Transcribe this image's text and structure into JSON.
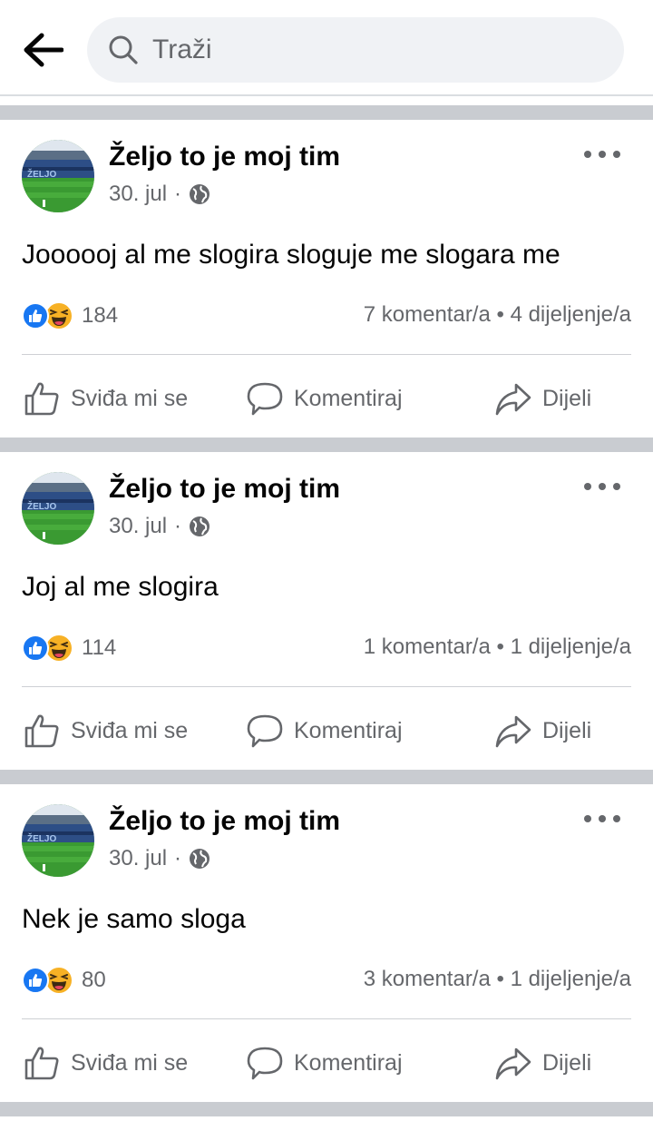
{
  "search": {
    "placeholder": "Traži"
  },
  "actions": {
    "like": "Sviđa mi se",
    "comment": "Komentiraj",
    "share": "Dijeli"
  },
  "posts": [
    {
      "author": "Željo to je moj tim",
      "date": "30. jul",
      "separator": "·",
      "text": "Joooooj al me slogira sloguje me slogara me",
      "reactions_count": "184",
      "stats": "7 komentar/a • 4 dijeljenje/a"
    },
    {
      "author": "Željo to je moj tim",
      "date": "30. jul",
      "separator": "·",
      "text": "Joj al me slogira",
      "reactions_count": "114",
      "stats": "1 komentar/a • 1 dijeljenje/a"
    },
    {
      "author": "Željo to je moj tim",
      "date": "30. jul",
      "separator": "·",
      "text": "Nek je samo sloga",
      "reactions_count": "80",
      "stats": "3 komentar/a • 1 dijeljenje/a"
    }
  ],
  "colors": {
    "accent": "#1877f2",
    "secondary_text": "#65676b",
    "separator": "#c9ccd1",
    "search_bg": "#f0f2f5"
  },
  "icons": {
    "back": "arrow-left-icon",
    "search": "search-icon",
    "globe": "globe-icon",
    "more": "more-dots-icon",
    "like": "thumbs-up-icon",
    "comment": "comment-bubble-icon",
    "share": "share-arrow-icon"
  }
}
